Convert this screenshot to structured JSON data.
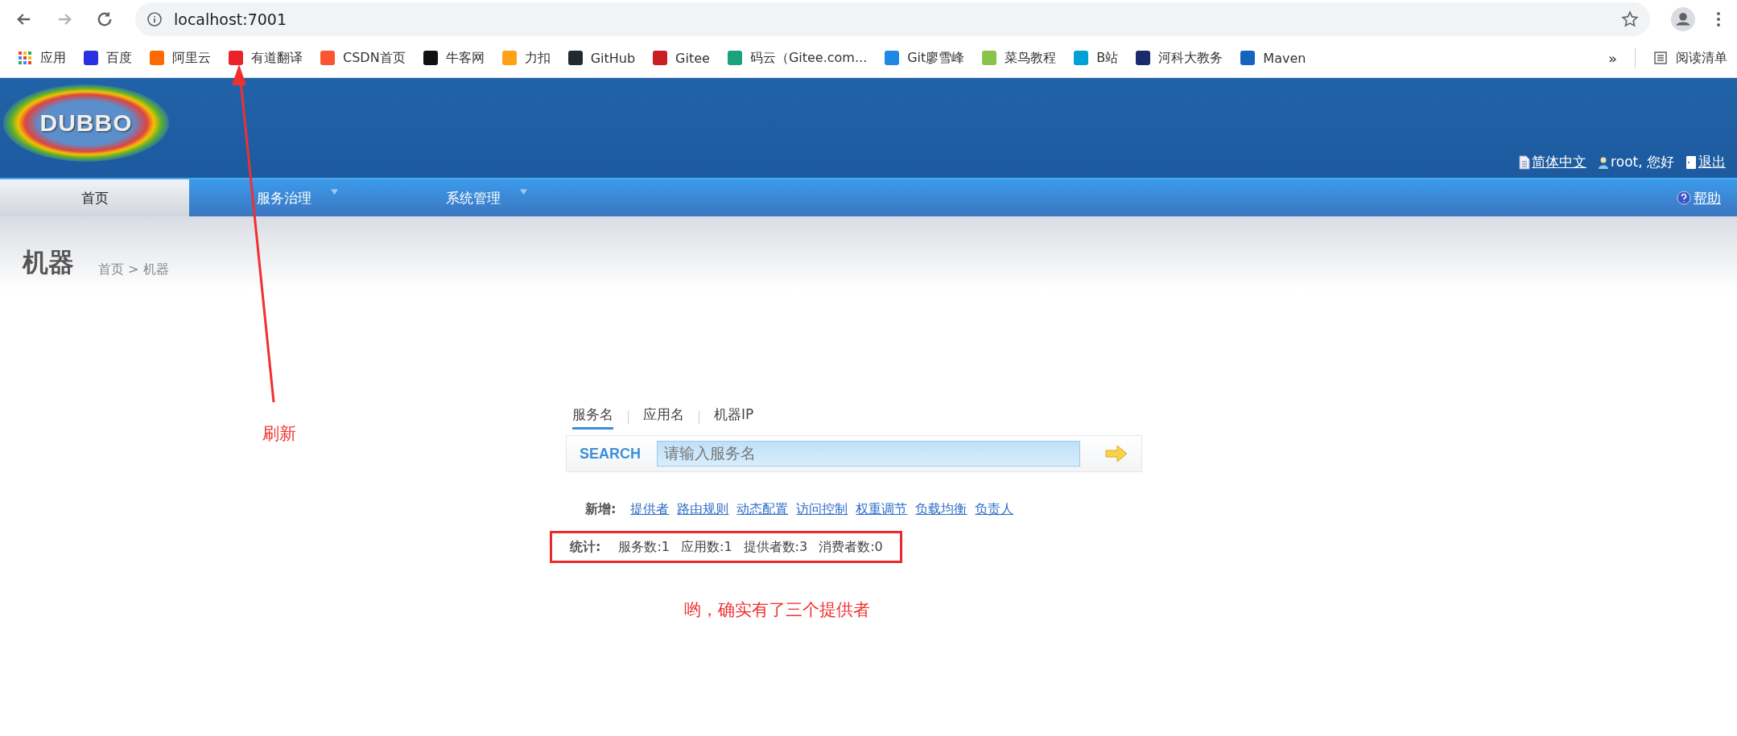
{
  "browser": {
    "url": "localhost:7001",
    "bookmarks": [
      {
        "label": "应用"
      },
      {
        "label": "百度"
      },
      {
        "label": "阿里云"
      },
      {
        "label": "有道翻译"
      },
      {
        "label": "CSDN首页"
      },
      {
        "label": "牛客网"
      },
      {
        "label": "力扣"
      },
      {
        "label": "GitHub"
      },
      {
        "label": "Gitee"
      },
      {
        "label": "码云（Gitee.com..."
      },
      {
        "label": "Git廖雪峰"
      },
      {
        "label": "菜鸟教程"
      },
      {
        "label": "B站"
      },
      {
        "label": "河科大教务"
      },
      {
        "label": "Maven"
      }
    ],
    "more": "»",
    "reading_list": "阅读清单"
  },
  "header": {
    "logo": "DUBBO",
    "links": [
      {
        "kind": "language",
        "label": "简体中文"
      },
      {
        "kind": "user",
        "label": "root, 您好"
      },
      {
        "kind": "logout",
        "label": "退出"
      }
    ]
  },
  "nav": {
    "items": [
      {
        "label": "首页",
        "selected": true,
        "dropdown": false
      },
      {
        "label": "服务治理",
        "selected": false,
        "dropdown": true
      },
      {
        "label": "系统管理",
        "selected": false,
        "dropdown": true
      }
    ],
    "help": "帮助"
  },
  "page": {
    "title": "机器",
    "breadcrumb": "首页 > 机器"
  },
  "search": {
    "tabs": [
      {
        "label": "服务名",
        "selected": true
      },
      {
        "label": "应用名",
        "selected": false
      },
      {
        "label": "机器IP",
        "selected": false
      }
    ],
    "brand": "SEARCH",
    "placeholder": "请输入服务名"
  },
  "add": {
    "label": "新增:",
    "links": [
      "提供者",
      "路由规则",
      "动态配置",
      "访问控制",
      "权重调节",
      "负载均衡",
      "负责人"
    ]
  },
  "stats": {
    "label": "统计:",
    "items": [
      "服务数:1",
      "应用数:1",
      "提供者数:3",
      "消费者数:0"
    ]
  },
  "annotations": {
    "refresh": "刷新",
    "note": "哟，确实有了三个提供者"
  }
}
